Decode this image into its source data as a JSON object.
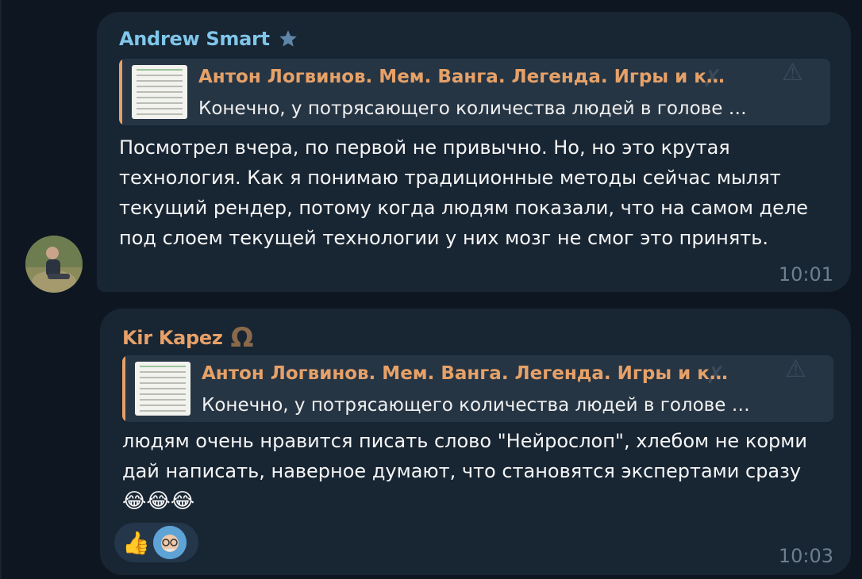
{
  "messages": [
    {
      "sender": "Andrew Smart",
      "sender_badge_icon": "star-icon",
      "reply": {
        "title": "Антон Логвинов. Мем. Ванга. Легенда. Игры и к…",
        "text": "Конечно, у потрясающего количества людей в голове …"
      },
      "text": "Посмотрел вчера, по первой не привычно. Но, но это крутая технология. Как я понимаю традиционные методы сейчас мылят текущий рендер, потому когда людям показали, что на самом деле под слоем текущей технологии у них мозг не смог это принять.",
      "time": "10:01"
    },
    {
      "sender": "Kir Kapez",
      "sender_badge": "Ω",
      "reply": {
        "title": "Антон Логвинов. Мем. Ванга. Легенда. Игры и к…",
        "text": "Конечно, у потрясающего количества людей в голове …"
      },
      "text": "людям очень нравится писать слово \"Нейрослоп\", хлебом не корми дай написать, наверное думают, что становятся экспертами сразу",
      "emojis": "😂😂😂",
      "reaction": "👍",
      "time": "10:03"
    }
  ],
  "colors": {
    "background": "#0e1621",
    "bubble": "#182533",
    "sender1": "#7fc6e9",
    "sender2": "#e6a168",
    "time": "#6d7f8f"
  }
}
